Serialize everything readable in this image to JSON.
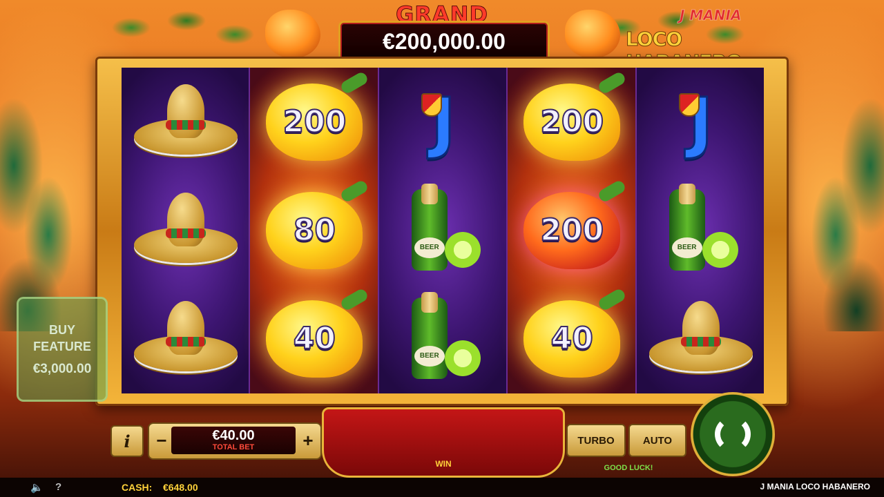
{
  "jackpot": {
    "label": "GRAND",
    "value": "€200,000.00"
  },
  "logo": {
    "line1": "J MANIA",
    "line2": "LOCO HABANERO"
  },
  "reels": [
    [
      "sombrero",
      "sombrero",
      "sombrero"
    ],
    [
      {
        "type": "pepper",
        "value": "200"
      },
      {
        "type": "pepper",
        "value": "80"
      },
      {
        "type": "pepper",
        "value": "40"
      }
    ],
    [
      "J",
      "beer",
      "beer"
    ],
    [
      {
        "type": "pepper",
        "value": "200"
      },
      {
        "type": "pepper-red",
        "value": "200"
      },
      {
        "type": "pepper",
        "value": "40"
      }
    ],
    [
      "J",
      "beer",
      "sombrero"
    ]
  ],
  "beer_label": "BEER",
  "buy_feature": {
    "line1": "BUY",
    "line2": "FEATURE",
    "price": "€3,000.00"
  },
  "controls": {
    "info_label": "i",
    "minus_label": "−",
    "plus_label": "+",
    "bet_value": "€40.00",
    "bet_label": "TOTAL BET",
    "win_label": "WIN",
    "turbo_label": "TURBO",
    "auto_label": "AUTO",
    "good_luck": "GOOD LUCK!"
  },
  "status_bar": {
    "sound_icon": "🔈",
    "help_icon": "?",
    "cash_label": "CASH:",
    "cash_value": "€648.00",
    "game_name": "J MANIA LOCO HABANERO"
  }
}
